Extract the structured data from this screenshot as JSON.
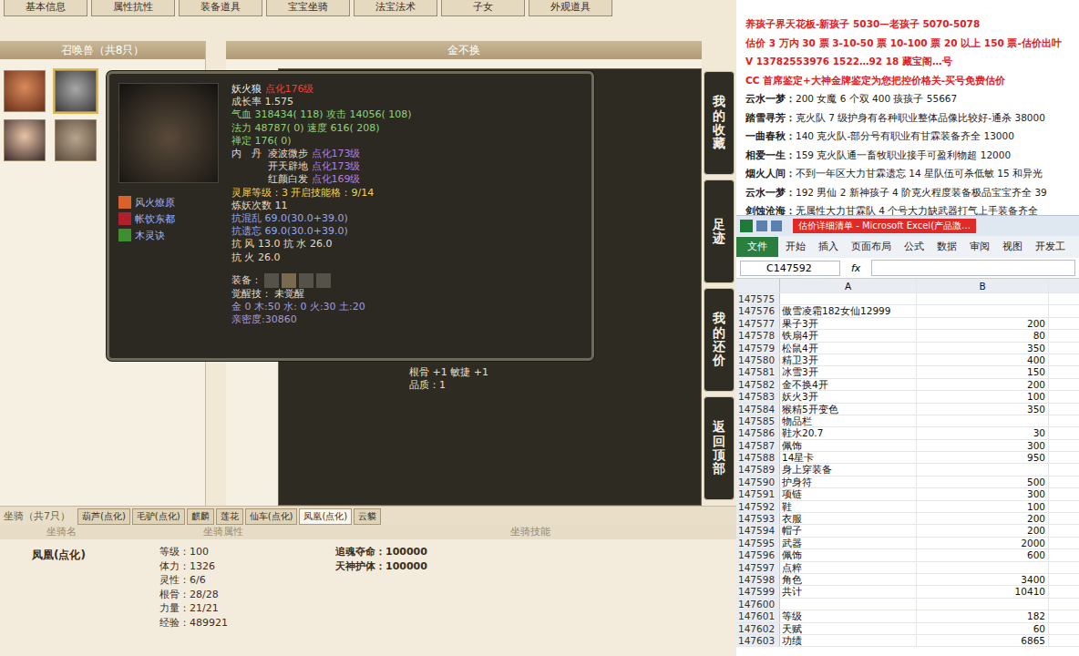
{
  "game": {
    "top_tabs": [
      "基本信息",
      "属性抗性",
      "装备道具",
      "宝宝坐骑",
      "法宝法术",
      "子女",
      "外观道具"
    ],
    "pets": {
      "title": "召唤兽（共8只）",
      "items": [
        {
          "selected": false
        },
        {
          "selected": true
        },
        {
          "selected": false
        },
        {
          "selected": false
        }
      ]
    },
    "seller": {
      "title": "金不换",
      "bonus": "根骨 +1 敏捷 +1",
      "quality": "品质：1"
    },
    "side_buttons": [
      "我的收藏",
      "足迹",
      "我的还价",
      "返回顶部"
    ],
    "tooltip": {
      "name": "妖火狼",
      "level": "点化176级",
      "lines_top": [
        {
          "kind": "plain",
          "text": "成长率 1.575"
        },
        {
          "kind": "stat",
          "text": "气血 318434( 118) 攻击 14056( 108)"
        },
        {
          "kind": "stat",
          "text": "法力 48787( 0) 速度 616( 208)"
        },
        {
          "kind": "stat",
          "text": "禅定 176( 0)"
        }
      ],
      "neidan": {
        "label": "内　丹",
        "items": [
          {
            "name": "凌波微步",
            "level": "点化173级"
          },
          {
            "name": "开天辟地",
            "level": "点化173级"
          },
          {
            "name": "红颜白发",
            "level": "点化169级"
          }
        ]
      },
      "lines_mid": [
        {
          "kind": "gold",
          "text": "灵犀等级：3 开启技能格：9/14"
        },
        {
          "kind": "plain",
          "text": "炼妖次数 11"
        },
        {
          "kind": "resist",
          "text": "抗混乱 69.0(30.0+39.0)"
        },
        {
          "kind": "resist",
          "text": "抗遗忘 69.0(30.0+39.0)"
        },
        {
          "kind": "plain",
          "text": "抗  风 13.0 抗  水 26.0"
        },
        {
          "kind": "plain",
          "text": "抗  火 26.0"
        }
      ],
      "equip_label": "装备：",
      "equip_slots": [
        {
          "filled": false
        },
        {
          "filled": true
        },
        {
          "filled": false
        },
        {
          "filled": false
        }
      ],
      "awaken_label": "觉醒技：",
      "awaken_value": "未觉醒",
      "elements": "金 0 木:50 水: 0 火:30 土:20",
      "intimacy": "亲密度:30860",
      "skills": [
        {
          "name": "风火燎原",
          "color": "#d9622b"
        },
        {
          "name": "帐饮东都",
          "color": "#b0202a"
        },
        {
          "name": "木灵诀",
          "color": "#3f8f2f"
        }
      ]
    },
    "mounts": {
      "title": "坐骑（共7只）",
      "tabs": [
        {
          "label": "葫芦(点化)",
          "selected": false
        },
        {
          "label": "毛驴(点化)",
          "selected": false
        },
        {
          "label": "麒麟",
          "selected": false
        },
        {
          "label": "莲花",
          "selected": false
        },
        {
          "label": "仙车(点化)",
          "selected": false
        },
        {
          "label": "凤凰(点化)",
          "selected": true
        },
        {
          "label": "云貘",
          "selected": false
        }
      ],
      "columns": [
        "坐骑名",
        "坐骑属性",
        "坐骑技能"
      ],
      "row": {
        "name": "凤凰(点化)",
        "attrs": [
          "等级：100",
          "体力：1326",
          "灵性：6/6",
          "根骨：28/28",
          "力量：21/21",
          "经验：489921"
        ],
        "skills": [
          "追魂夺命：100000",
          "天神护体：100000"
        ]
      }
    }
  },
  "notice": {
    "headlines": [
      "养孩子界天花板-新孩子 5030—老孩子 5070-5078",
      "估价 3 万内 30 票 3-10-50 票 10-100 票 20 以上 150 票-估价出叶",
      "V 13782553976    1522…92 18   藏宝阁…号",
      "CC 首席鉴定+大神金牌鉴定为您把控价格关-买号免费估价"
    ],
    "entries": [
      {
        "name": "云水一梦：",
        "text": "200 女魔 6 个双 400 孩孩子 55667"
      },
      {
        "name": "踏雪寻芳：",
        "text": "克火队 7 级护身有各种职业整体品像比较好-通杀 38000"
      },
      {
        "name": "一曲春秋：",
        "text": "140 克火队-部分号有职业有甘霖装备齐全 13000"
      },
      {
        "name": "相爱一生：",
        "text": "159 克火队通一畜牧职业接手可盈利物超 12000"
      },
      {
        "name": "烟火人间：",
        "text": "不到一年区大力甘霖遗忘 14 星队伍可杀低敏 15 和异光"
      },
      {
        "name": "云水一梦：",
        "text": "192 男仙 2 新神孩子 4 阶克火程度装备极品宝宝齐全 39"
      },
      {
        "name": "剑蚀沧海：",
        "text": "无属性大力甘霖队 4 个号大力缺武器打气上手装备齐全"
      }
    ]
  },
  "excel": {
    "title": "估价详细清单 - Microsoft Excel(产品激…",
    "ribbon": [
      {
        "label": "文件",
        "selected": true
      },
      {
        "label": "开始",
        "selected": false
      },
      {
        "label": "插入",
        "selected": false
      },
      {
        "label": "页面布局",
        "selected": false
      },
      {
        "label": "公式",
        "selected": false
      },
      {
        "label": "数据",
        "selected": false
      },
      {
        "label": "审阅",
        "selected": false
      },
      {
        "label": "视图",
        "selected": false
      },
      {
        "label": "开发工",
        "selected": false
      }
    ],
    "name_box": "C147592",
    "fx": "fx",
    "columns": [
      "A",
      "B"
    ],
    "rows": [
      {
        "num": "147575",
        "a": "",
        "b": ""
      },
      {
        "num": "147576",
        "a": "傲雪凌霜182女仙12999",
        "b": ""
      },
      {
        "num": "147577",
        "a": "果子3开",
        "b": "200"
      },
      {
        "num": "147578",
        "a": "铁扇4开",
        "b": "80"
      },
      {
        "num": "147579",
        "a": "松鼠4开",
        "b": "350"
      },
      {
        "num": "147580",
        "a": "精卫3开",
        "b": "400"
      },
      {
        "num": "147581",
        "a": "冰雪3开",
        "b": "150"
      },
      {
        "num": "147582",
        "a": "金不换4开",
        "b": "200"
      },
      {
        "num": "147583",
        "a": "妖火3开",
        "b": "100"
      },
      {
        "num": "147584",
        "a": "猴精5开变色",
        "b": "350"
      },
      {
        "num": "147585",
        "a": "物品栏",
        "b": ""
      },
      {
        "num": "147586",
        "a": "鞋水20.7",
        "b": "30"
      },
      {
        "num": "147587",
        "a": "佩饰",
        "b": "300"
      },
      {
        "num": "147588",
        "a": "14星卡",
        "b": "950"
      },
      {
        "num": "147589",
        "a": "身上穿装备",
        "b": ""
      },
      {
        "num": "147590",
        "a": "护身符",
        "b": "500"
      },
      {
        "num": "147591",
        "a": "项链",
        "b": "300"
      },
      {
        "num": "147592",
        "a": "鞋",
        "b": "100"
      },
      {
        "num": "147593",
        "a": "衣服",
        "b": "200"
      },
      {
        "num": "147594",
        "a": "帽子",
        "b": "200"
      },
      {
        "num": "147595",
        "a": "武器",
        "b": "2000"
      },
      {
        "num": "147596",
        "a": "佩饰",
        "b": "600"
      },
      {
        "num": "147597",
        "a": "点粹",
        "b": ""
      },
      {
        "num": "147598",
        "a": "角色",
        "b": "3400"
      },
      {
        "num": "147599",
        "a": "共计",
        "b": "10410"
      },
      {
        "num": "147600",
        "a": "",
        "b": ""
      },
      {
        "num": "147601",
        "a": "等级",
        "b": "182"
      },
      {
        "num": "147602",
        "a": "天赋",
        "b": "60"
      },
      {
        "num": "147603",
        "a": "功绩",
        "b": "6865"
      }
    ]
  }
}
